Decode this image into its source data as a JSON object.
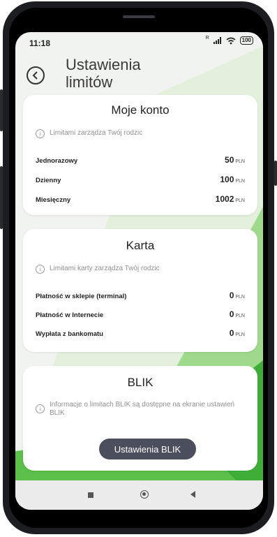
{
  "status_bar": {
    "time": "11:18",
    "signal_label": "R",
    "battery": "100",
    "icons": [
      "signal-icon",
      "wifi-icon",
      "battery-icon"
    ]
  },
  "header": {
    "back_icon": "chevron-left-icon",
    "title": "Ustawienia limitów"
  },
  "cards": {
    "account": {
      "title": "Moje konto",
      "info": "Limitami zarządza Twój rodzic",
      "rows": [
        {
          "label": "Jednorazowy",
          "value": "50",
          "currency": "PLN"
        },
        {
          "label": "Dzienny",
          "value": "100",
          "currency": "PLN"
        },
        {
          "label": "Miesięczny",
          "value": "1002",
          "currency": "PLN"
        }
      ]
    },
    "card": {
      "title": "Karta",
      "info": "Limitami karty zarządza Twój rodzic",
      "rows": [
        {
          "label": "Płatność w sklepie (terminal)",
          "value": "0",
          "currency": "PLN"
        },
        {
          "label": "Płatność w Internecie",
          "value": "0",
          "currency": "PLN"
        },
        {
          "label": "Wypłata z bankomatu",
          "value": "0",
          "currency": "PLN"
        }
      ]
    },
    "blik": {
      "title": "BLIK",
      "info": "Informacje o limitach BLIK są dostępne na ekranie ustawień BLIK",
      "button_label": "Ustawienia BLIK"
    }
  },
  "colors": {
    "accent_green": "#5cbf4a",
    "button_bg": "#4a4e5d",
    "card_bg": "#ffffff"
  }
}
